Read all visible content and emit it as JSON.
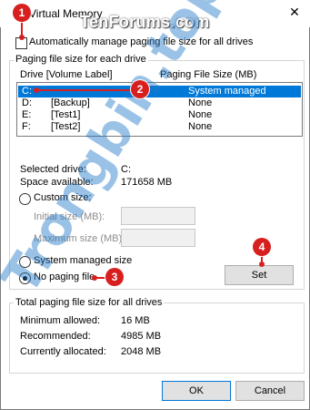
{
  "window": {
    "title": "Virtual Memory",
    "watermark_top": "TenForums.com",
    "close_glyph": "✕"
  },
  "auto_manage": {
    "label": "Automatically manage paging file size for all drives",
    "checked": false
  },
  "per_drive_group": {
    "title": "Paging file size for each drive"
  },
  "drive_list": {
    "col_drive": "Drive  [Volume Label]",
    "col_size": "Paging File Size (MB)",
    "rows": [
      {
        "drive": "C:",
        "label": "",
        "size": "System managed",
        "selected": true
      },
      {
        "drive": "D:",
        "label": "[Backup]",
        "size": "None",
        "selected": false
      },
      {
        "drive": "E:",
        "label": "[Test1]",
        "size": "None",
        "selected": false
      },
      {
        "drive": "F:",
        "label": "[Test2]",
        "size": "None",
        "selected": false
      }
    ]
  },
  "selected_info": {
    "drive_label": "Selected drive:",
    "drive_value": "C:",
    "space_label": "Space available:",
    "space_value": "171658 MB"
  },
  "options": {
    "custom_size": "Custom size:",
    "initial_size": "Initial size (MB):",
    "maximum_size": "Maximum size (MB):",
    "system_managed": "System managed size",
    "no_paging": "No paging file",
    "selected": "no_paging"
  },
  "set_button": "Set",
  "totals_group": {
    "title": "Total paging file size for all drives",
    "min_label": "Minimum allowed:",
    "min_value": "16 MB",
    "rec_label": "Recommended:",
    "rec_value": "4985 MB",
    "cur_label": "Currently allocated:",
    "cur_value": "2048 MB"
  },
  "buttons": {
    "ok": "OK",
    "cancel": "Cancel"
  },
  "callouts": [
    "1",
    "2",
    "3",
    "4"
  ],
  "watermark_diag": "Trongbin.top",
  "colors": {
    "selection": "#0078d7",
    "callout": "#d81f1f",
    "watermark": "#1e78c8"
  }
}
